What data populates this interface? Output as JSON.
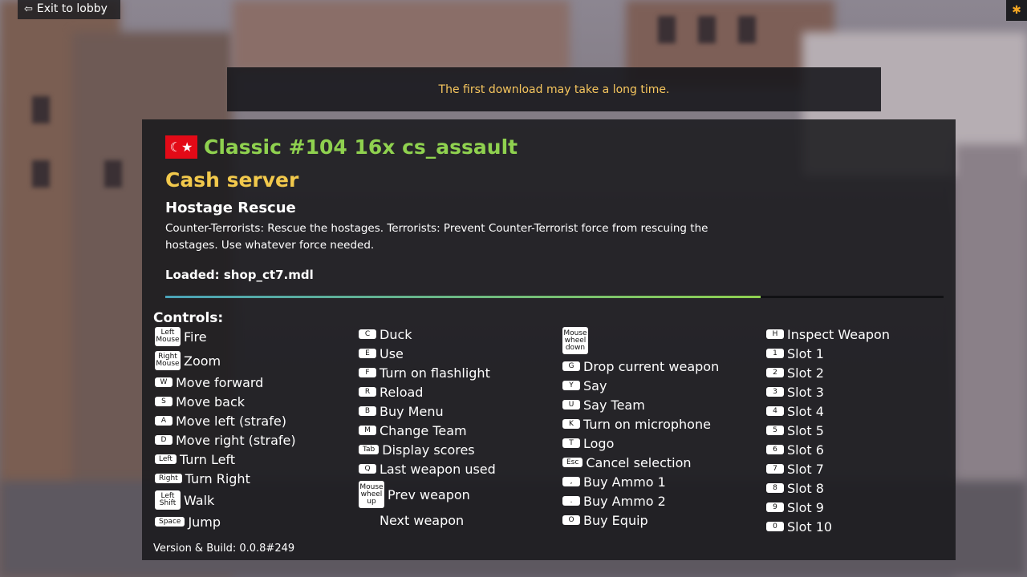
{
  "topbar": {
    "exit_label": "Exit to lobby"
  },
  "notice": "The first download may take a long time.",
  "server": {
    "flag": "Turkey",
    "flag_symbol": "☾★",
    "name": "Classic #104 16x cs_assault",
    "type": "Cash server",
    "mode": "Hostage Rescue",
    "description": "Counter-Terrorists: Rescue the hostages. Terrorists: Prevent Counter-Terrorist force from rescuing the hostages. Use whatever force needed.",
    "loaded": "Loaded: shop_ct7.mdl",
    "progress": 0.765
  },
  "controls": {
    "label": "Controls:",
    "columns": [
      [
        {
          "key": "Left Mouse",
          "action": "Fire"
        },
        {
          "key": "Right Mouse",
          "action": "Zoom"
        },
        {
          "key": "W",
          "action": "Move forward"
        },
        {
          "key": "S",
          "action": "Move back"
        },
        {
          "key": "A",
          "action": "Move left (strafe)"
        },
        {
          "key": "D",
          "action": "Move right (strafe)"
        },
        {
          "key": "Left",
          "action": "Turn Left"
        },
        {
          "key": "Right",
          "action": "Turn Right"
        },
        {
          "key": "Left Shift",
          "action": "Walk"
        },
        {
          "key": "Space",
          "action": "Jump"
        }
      ],
      [
        {
          "key": "C",
          "action": "Duck"
        },
        {
          "key": "E",
          "action": "Use"
        },
        {
          "key": "F",
          "action": "Turn on flashlight"
        },
        {
          "key": "R",
          "action": "Reload"
        },
        {
          "key": "B",
          "action": "Buy Menu"
        },
        {
          "key": "M",
          "action": "Change Team"
        },
        {
          "key": "Tab",
          "action": "Display scores"
        },
        {
          "key": "Q",
          "action": "Last weapon used"
        },
        {
          "key": "Mouse wheel up",
          "action": "Prev weapon"
        },
        {
          "key": "",
          "action": "Next weapon"
        }
      ],
      [
        {
          "key": "Mouse wheel down",
          "action": ""
        },
        {
          "key": "G",
          "action": "Drop current weapon"
        },
        {
          "key": "Y",
          "action": "Say"
        },
        {
          "key": "U",
          "action": "Say Team"
        },
        {
          "key": "K",
          "action": "Turn on microphone"
        },
        {
          "key": "T",
          "action": "Logo"
        },
        {
          "key": "Esc",
          "action": "Cancel selection"
        },
        {
          "key": ",",
          "action": "Buy Ammo 1"
        },
        {
          "key": ".",
          "action": "Buy Ammo 2"
        },
        {
          "key": "O",
          "action": "Buy Equip"
        }
      ],
      [
        {
          "key": "H",
          "action": "Inspect Weapon"
        },
        {
          "key": "1",
          "action": "Slot 1"
        },
        {
          "key": "2",
          "action": "Slot 2"
        },
        {
          "key": "3",
          "action": "Slot 3"
        },
        {
          "key": "4",
          "action": "Slot 4"
        },
        {
          "key": "5",
          "action": "Slot 5"
        },
        {
          "key": "6",
          "action": "Slot 6"
        },
        {
          "key": "7",
          "action": "Slot 7"
        },
        {
          "key": "8",
          "action": "Slot 8"
        },
        {
          "key": "9",
          "action": "Slot 9"
        },
        {
          "key": "0",
          "action": "Slot 10"
        }
      ]
    ]
  },
  "version": "Version & Build: 0.0.8#249"
}
